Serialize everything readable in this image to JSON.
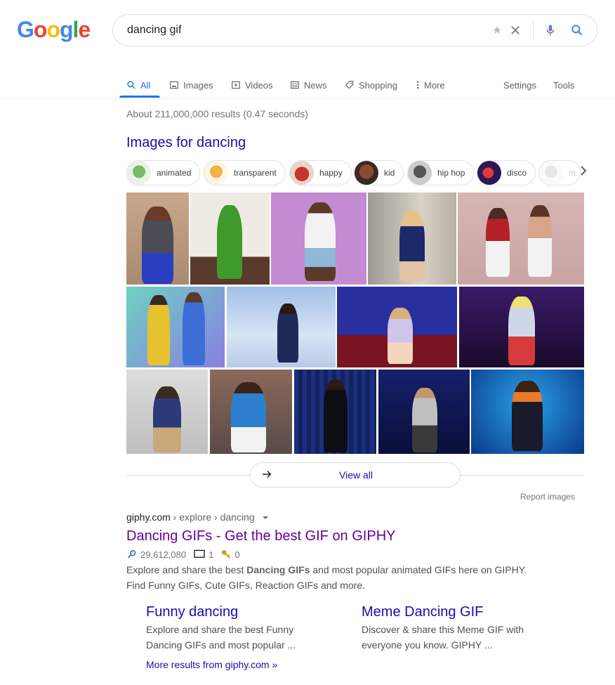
{
  "logo": {
    "letters": [
      "G",
      "o",
      "o",
      "g",
      "l",
      "e"
    ],
    "colors": [
      "#4285f4",
      "#ea4335",
      "#fbbc05",
      "#4285f4",
      "#34a853",
      "#ea4335"
    ]
  },
  "search": {
    "query": "dancing gif"
  },
  "tabs": [
    {
      "label": "All",
      "icon": "search-icon",
      "active": true
    },
    {
      "label": "Images",
      "icon": "image-icon"
    },
    {
      "label": "Videos",
      "icon": "video-icon"
    },
    {
      "label": "News",
      "icon": "news-icon"
    },
    {
      "label": "Shopping",
      "icon": "tag-icon"
    },
    {
      "label": "More",
      "icon": "more-vert-icon"
    }
  ],
  "tools": {
    "settings": "Settings",
    "tools": "Tools"
  },
  "stats": "About 211,000,000 results (0.47 seconds)",
  "images_heading": "Images for dancing",
  "chips": [
    {
      "label": "animated",
      "color": "#cfe8c9"
    },
    {
      "label": "transparent",
      "color": "#f1c27d"
    },
    {
      "label": "happy",
      "color": "#c8332f"
    },
    {
      "label": "kid",
      "color": "#6b3a2a"
    },
    {
      "label": "hip hop",
      "color": "#9a9a9a"
    },
    {
      "label": "disco",
      "color": "#7a1f3d"
    },
    {
      "label": "m",
      "color": "#f0f0f0"
    }
  ],
  "view_all": "View all",
  "report_images": "Report images",
  "result": {
    "domain": "giphy.com",
    "path": " › explore › dancing",
    "title": "Dancing GIFs - Get the best GIF on GIPHY",
    "views": "29,612,080",
    "comments": "1",
    "keys": "0",
    "snippet_pre": "Explore and share the best ",
    "snippet_bold": "Dancing GIFs",
    "snippet_post": " and most popular animated GIFs here on GIPHY. Find Funny GIFs, Cute GIFs, Reaction GIFs and more."
  },
  "sitelinks": [
    {
      "title": "Funny dancing",
      "desc": "Explore and share the best Funny Dancing GIFs and most popular ..."
    },
    {
      "title": "Meme Dancing GIF",
      "desc": "Discover & share this Meme GIF with everyone you know. GIPHY ..."
    }
  ],
  "more_results": "More results from giphy.com »"
}
